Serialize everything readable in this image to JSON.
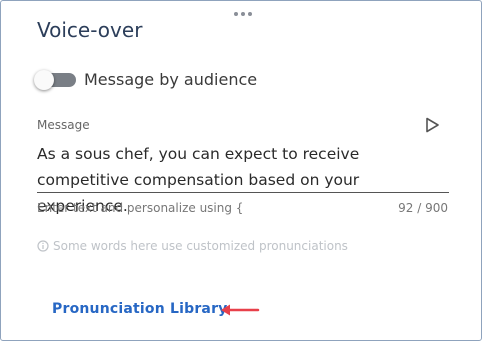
{
  "panel": {
    "title": "Voice-over"
  },
  "toggle": {
    "label": "Message by audience",
    "checked": false
  },
  "message": {
    "label": "Message",
    "text": "As a sous chef, you can expect to receive competitive compensation based on your experience.",
    "hint": "Enter text and personalize using {",
    "counter": "92 / 900"
  },
  "info": {
    "text": "Some words here use customized pronunciations"
  },
  "library": {
    "link_label": "Pronunciation Library"
  },
  "colors": {
    "link": "#2767c4",
    "arrow": "#e8404a",
    "title": "#2c3e5a",
    "border": "#8fa3bd"
  },
  "icons": {
    "play": "play-icon",
    "info": "info-icon",
    "drag": "drag-handle-icon",
    "arrow": "arrow-left-icon"
  }
}
